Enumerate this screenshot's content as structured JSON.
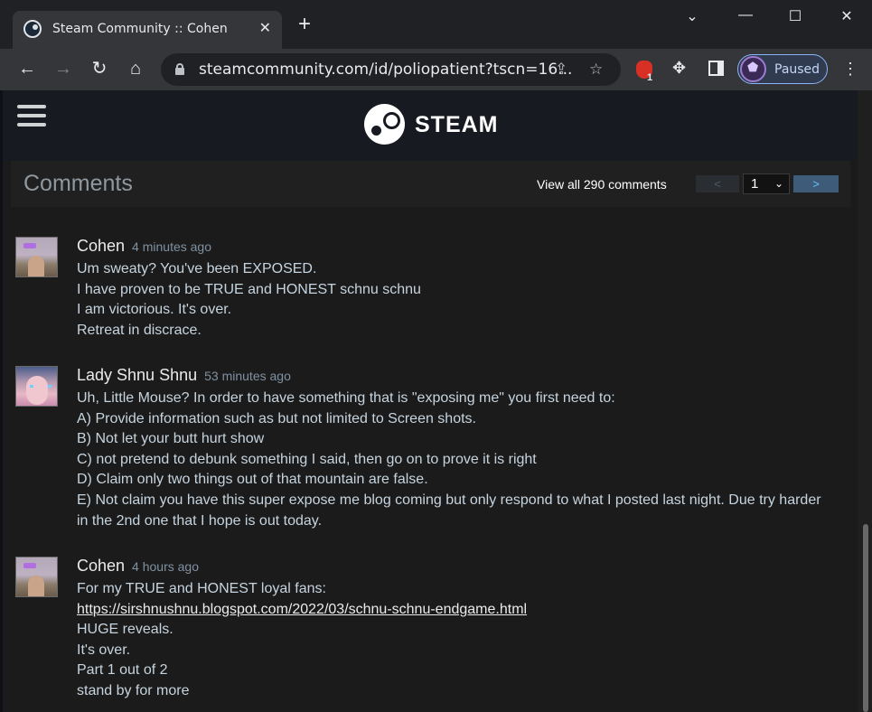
{
  "browser": {
    "tab_title": "Steam Community :: Cohen",
    "url": "steamcommunity.com/id/poliopatient?tscn=16...",
    "profile_label": "Paused",
    "extension_badge": "1",
    "icons": [
      "back-arrow-icon",
      "forward-arrow-icon",
      "reload-icon",
      "home-icon",
      "lock-icon",
      "share-icon",
      "star-icon",
      "extension-icon",
      "puzzle-icon",
      "sidepanel-icon",
      "kebab-menu-icon"
    ]
  },
  "steam": {
    "logo_text": "STEAM"
  },
  "comments": {
    "title": "Comments",
    "view_all": "View all 290 comments",
    "page_prev": "<",
    "page_current": "1",
    "page_next": ">",
    "items": [
      {
        "author": "Cohen",
        "time": "4 minutes ago",
        "lines": [
          "Um sweaty? You've been EXPOSED.",
          "I have proven to be TRUE and HONEST schnu schnu",
          "I am victorious. It's over.",
          "Retreat in discrace."
        ]
      },
      {
        "author": "Lady Shnu Shnu",
        "time": "53 minutes ago",
        "lines": [
          "Uh, Little Mouse? In order to have something that is \"exposing me\" you first need to:",
          "A) Provide information such as but not limited to Screen shots.",
          "B) Not let your butt hurt show",
          "C) not pretend to debunk something I said, then go on to prove it is right",
          "D) Claim only two things out of that mountain are false.",
          "E) Not claim you have this super expose me blog coming but only respond to what I posted last night. Due try harder in the 2nd one that I hope is out today."
        ]
      },
      {
        "author": "Cohen",
        "time": "4 hours ago",
        "lines": [
          "For my TRUE and HONEST loyal fans:",
          "https://sirshnushnu.blogspot.com/2022/03/schnu-schnu-endgame.html",
          "HUGE reveals.",
          "It's over.",
          "Part 1 out of 2",
          "stand by for more"
        ]
      }
    ]
  }
}
